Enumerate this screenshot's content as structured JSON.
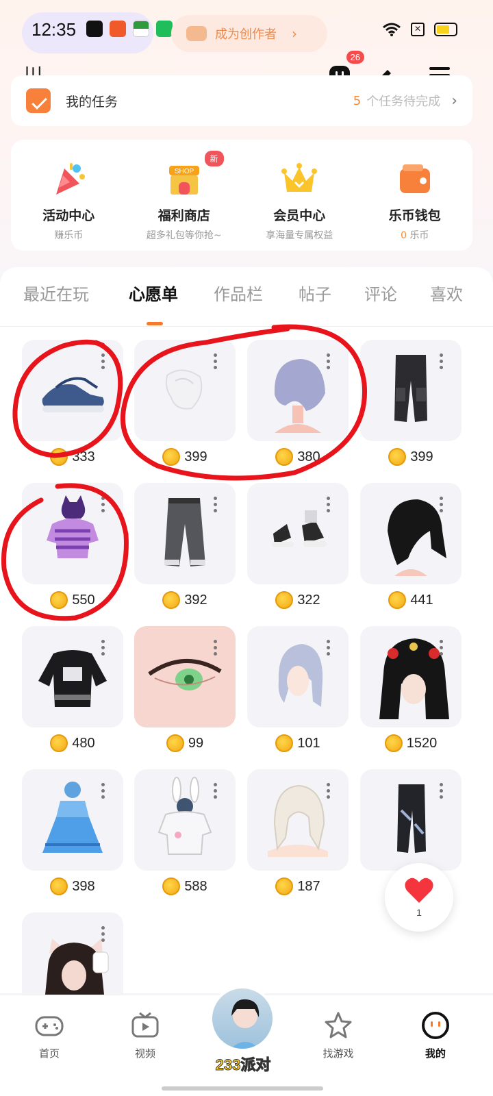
{
  "status_bar": {
    "time": "12:35"
  },
  "creator_banner": {
    "label": "成为创作者"
  },
  "profile": {
    "username": "川.",
    "unread_count": "26"
  },
  "tasks": {
    "title": "我的任务",
    "pending_count": "5",
    "pending_text": "个任务待完成"
  },
  "quick_tiles": [
    {
      "label": "活动中心",
      "sub": "赚乐币"
    },
    {
      "label": "福利商店",
      "sub": "超多礼包等你抢~",
      "badge": "新"
    },
    {
      "label": "会员中心",
      "sub": "享海量专属权益"
    },
    {
      "label": "乐币钱包",
      "sub_num": "0",
      "sub": "乐币"
    }
  ],
  "tabs": [
    {
      "label": "最近在玩",
      "active": false
    },
    {
      "label": "心愿单",
      "active": true
    },
    {
      "label": "作品栏",
      "active": false
    },
    {
      "label": "帖子",
      "active": false
    },
    {
      "label": "评论",
      "active": false
    },
    {
      "label": "喜欢",
      "active": false
    }
  ],
  "wishlist": [
    {
      "item": "sneakers-blue",
      "price": "333"
    },
    {
      "item": "white-fluffy-tail",
      "price": "399"
    },
    {
      "item": "silver-short-hair",
      "price": "380"
    },
    {
      "item": "black-cargo-pants",
      "price": "399"
    },
    {
      "item": "purple-cat-hoodie",
      "price": "550"
    },
    {
      "item": "grey-wide-pants",
      "price": "392"
    },
    {
      "item": "high-top-sneakers",
      "price": "322"
    },
    {
      "item": "black-wolf-hair",
      "price": "441"
    },
    {
      "item": "black-sweater",
      "price": "480"
    },
    {
      "item": "green-eyes",
      "price": "99"
    },
    {
      "item": "silver-long-hair",
      "price": "101"
    },
    {
      "item": "ornate-black-hair",
      "price": "1520"
    },
    {
      "item": "blue-dress",
      "price": "398"
    },
    {
      "item": "bunny-hoodie",
      "price": "588"
    },
    {
      "item": "white-braids-hair",
      "price": "187"
    },
    {
      "item": "black-belted-pants",
      "price": ""
    },
    {
      "item": "cat-ear-hair",
      "price": ""
    }
  ],
  "favorites": {
    "count": "1"
  },
  "bottom_nav": [
    {
      "label": "首页",
      "icon": "gamepad-icon",
      "active": false
    },
    {
      "label": "视频",
      "icon": "tv-icon",
      "active": false
    },
    {
      "label": "233派对",
      "icon": "party-avatar",
      "active": false
    },
    {
      "label": "找游戏",
      "icon": "star-icon",
      "active": false
    },
    {
      "label": "我的",
      "icon": "me-face-icon",
      "active": true
    }
  ],
  "colors": {
    "accent": "#f57a2e",
    "annotation_red": "#e8141c",
    "badge_red": "#f54b4b"
  }
}
